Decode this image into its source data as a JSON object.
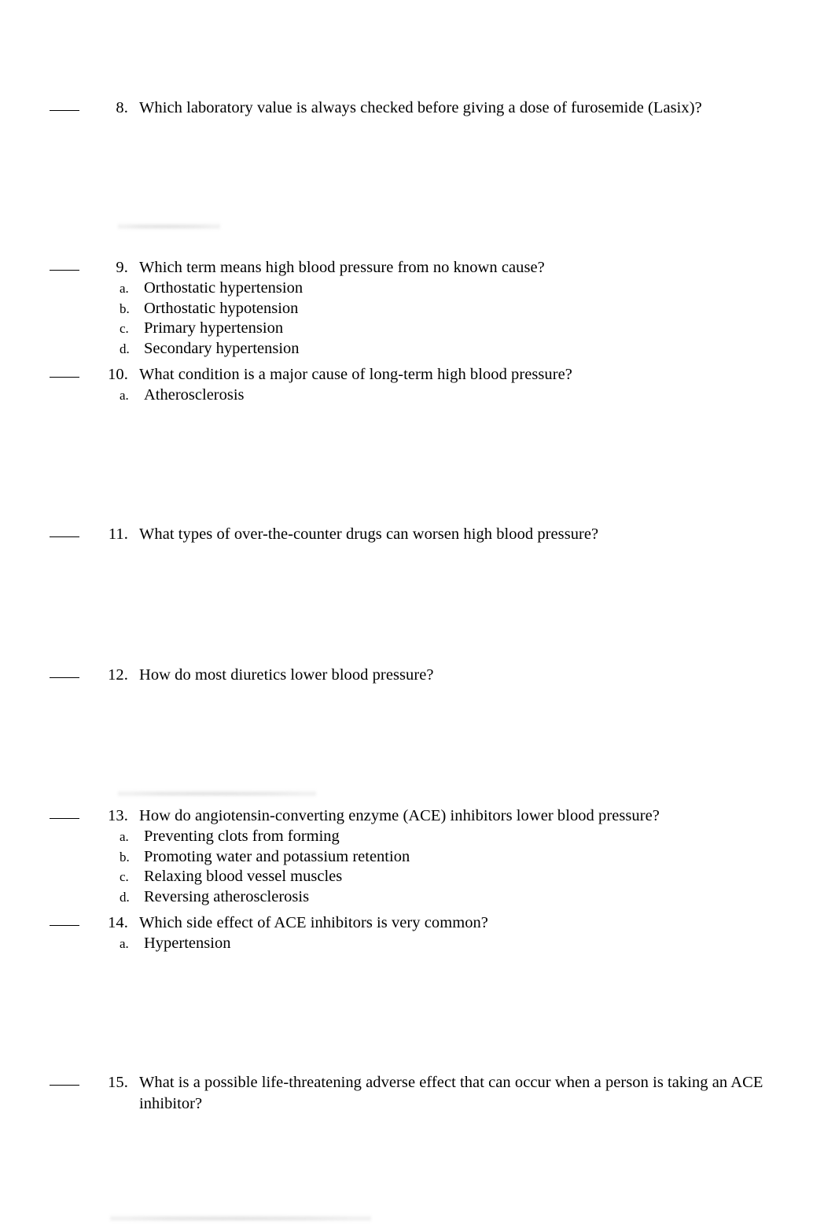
{
  "document": {
    "type": "multiple-choice-quiz",
    "page_background": "#ffffff",
    "text_color": "#000000",
    "questions": [
      {
        "number": "8.",
        "text": "Which laboratory value is always checked before giving a dose of furosemide (Lasix)?",
        "options": []
      },
      {
        "number": "9.",
        "text": "Which term means high blood pressure from no known cause?",
        "options": [
          {
            "letter": "a.",
            "text": "Orthostatic hypertension"
          },
          {
            "letter": "b.",
            "text": "Orthostatic hypotension"
          },
          {
            "letter": "c.",
            "text": "Primary hypertension"
          },
          {
            "letter": "d.",
            "text": "Secondary hypertension"
          }
        ]
      },
      {
        "number": "10.",
        "text": "What condition is a major cause of long-term high blood pressure?",
        "options": [
          {
            "letter": "a.",
            "text": "Atherosclerosis"
          }
        ]
      },
      {
        "number": "11.",
        "text": "What types of over-the-counter drugs can worsen high blood pressure?",
        "options": []
      },
      {
        "number": "12.",
        "text": "How do most diuretics lower blood pressure?",
        "options": []
      },
      {
        "number": "13.",
        "text": "How do angiotensin-converting enzyme (ACE) inhibitors lower blood pressure?",
        "options": [
          {
            "letter": "a.",
            "text": "Preventing clots from forming"
          },
          {
            "letter": "b.",
            "text": "Promoting water and potassium retention"
          },
          {
            "letter": "c.",
            "text": "Relaxing blood vessel muscles"
          },
          {
            "letter": "d.",
            "text": "Reversing atherosclerosis"
          }
        ]
      },
      {
        "number": "14.",
        "text": "Which side effect of ACE inhibitors is very common?",
        "options": [
          {
            "letter": "a.",
            "text": "Hypertension"
          }
        ]
      },
      {
        "number": "15.",
        "text": "What is a possible life-threatening adverse effect that can occur when a person is taking an ACE inhibitor?",
        "options": []
      }
    ]
  }
}
